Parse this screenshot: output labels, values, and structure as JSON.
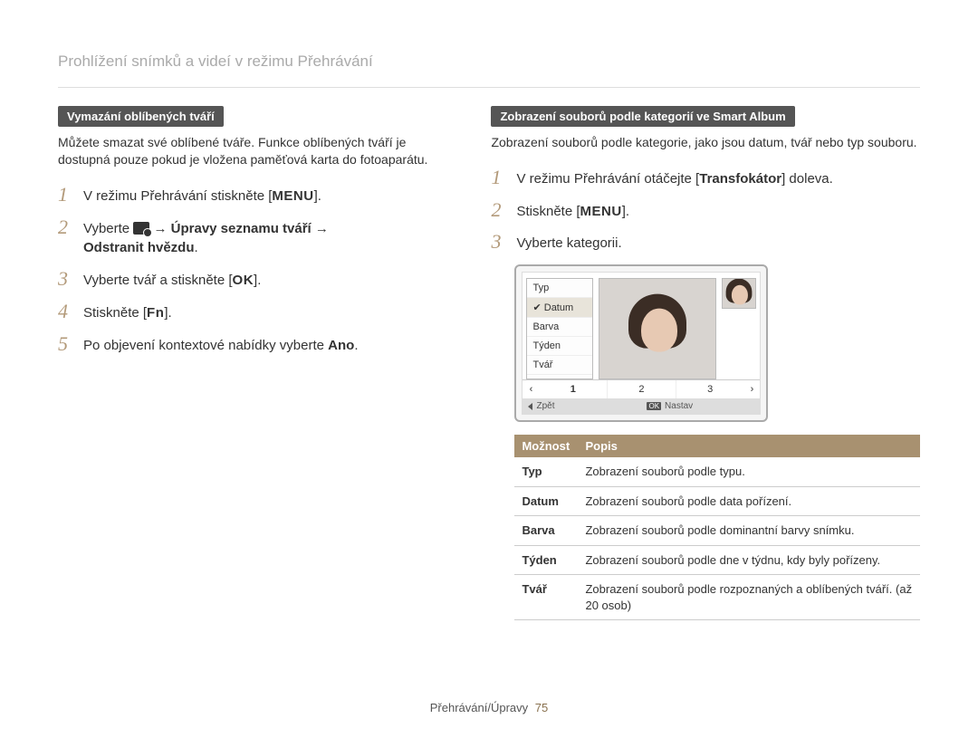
{
  "page_title": "Prohlížení snímků a videí v režimu Přehrávání",
  "left": {
    "section_label": "Vymazání oblíbených tváří",
    "intro": "Můžete smazat své oblíbené tváře. Funkce oblíbených tváří je dostupná pouze pokud je vložena paměťová karta do fotoaparátu.",
    "steps": {
      "s1_a": "V režimu Přehrávání stiskněte [",
      "s1_btn": "MENU",
      "s1_b": "].",
      "s2_a": "Vyberte ",
      "s2_arrow1": " → ",
      "s2_b": "Úpravy seznamu tváří",
      "s2_arrow2": " → ",
      "s2_c": "Odstranit hvězdu",
      "s2_d": ".",
      "s3_a": "Vyberte tvář a stiskněte [",
      "s3_btn": "OK",
      "s3_b": "].",
      "s4_a": "Stiskněte [",
      "s4_btn": "Fn",
      "s4_b": "].",
      "s5_a": "Po objevení kontextové nabídky vyberte ",
      "s5_b": "Ano",
      "s5_c": "."
    }
  },
  "right": {
    "section_label": "Zobrazení souborů podle kategorií ve Smart Album",
    "intro": "Zobrazení souborů podle kategorie, jako jsou datum, tvář nebo typ souboru.",
    "steps": {
      "s1_a": "V režimu Přehrávání otáčejte [",
      "s1_b": "Transfokátor",
      "s1_c": "] doleva.",
      "s2_a": "Stiskněte [",
      "s2_btn": "MENU",
      "s2_b": "].",
      "s3": "Vyberte kategorii."
    },
    "screen": {
      "menu": [
        "Typ",
        "Datum",
        "Barva",
        "Týden",
        "Tvář"
      ],
      "selected_index": 1,
      "pages": [
        "1",
        "2",
        "3"
      ],
      "back": "Zpět",
      "ok": "OK",
      "set": "Nastav"
    },
    "table": {
      "h1": "Možnost",
      "h2": "Popis",
      "rows": [
        {
          "k": "Typ",
          "v": "Zobrazení souborů podle typu."
        },
        {
          "k": "Datum",
          "v": "Zobrazení souborů podle data pořízení."
        },
        {
          "k": "Barva",
          "v": "Zobrazení souborů podle dominantní barvy snímku."
        },
        {
          "k": "Týden",
          "v": "Zobrazení souborů podle dne v týdnu, kdy byly pořízeny."
        },
        {
          "k": "Tvář",
          "v": "Zobrazení souborů podle rozpoznaných a oblíbených tváří. (až 20 osob)"
        }
      ]
    }
  },
  "footer": {
    "section": "Přehrávání/Úpravy",
    "page": "75"
  }
}
